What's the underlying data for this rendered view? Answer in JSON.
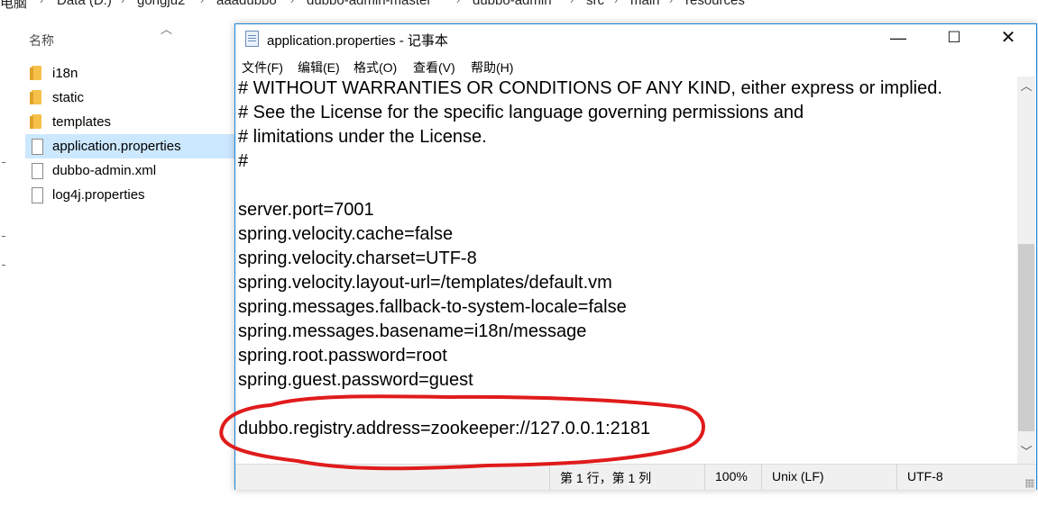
{
  "explorer": {
    "breadcrumb": [
      "此电脑",
      "Data (D:)",
      "gongju2",
      "aaadubbo",
      "dubbo-admin-master",
      "dubbo-admin",
      "src",
      "main",
      "resources"
    ],
    "column_header": "名称",
    "files": [
      {
        "name": "i18n",
        "type": "folder"
      },
      {
        "name": "static",
        "type": "folder"
      },
      {
        "name": "templates",
        "type": "folder"
      },
      {
        "name": "application.properties",
        "type": "file",
        "selected": true
      },
      {
        "name": "dubbo-admin.xml",
        "type": "file"
      },
      {
        "name": "log4j.properties",
        "type": "file"
      }
    ]
  },
  "notepad": {
    "title": "application.properties - 记事本",
    "menu": [
      "文件(F)",
      "编辑(E)",
      "格式(O)",
      "查看(V)",
      "帮助(H)"
    ],
    "lines": [
      "# WITHOUT WARRANTIES OR CONDITIONS OF ANY KIND, either express or implied.",
      "# See the License for the specific language governing permissions and",
      "# limitations under the License.",
      "#",
      "",
      "server.port=7001",
      "spring.velocity.cache=false",
      "spring.velocity.charset=UTF-8",
      "spring.velocity.layout-url=/templates/default.vm",
      "spring.messages.fallback-to-system-locale=false",
      "spring.messages.basename=i18n/message",
      "spring.root.password=root",
      "spring.guest.password=guest",
      "",
      "dubbo.registry.address=zookeeper://127.0.0.1:2181"
    ],
    "status": {
      "position": "第 1 行，第 1 列",
      "zoom": "100%",
      "line_ending": "Unix (LF)",
      "encoding": "UTF-8"
    }
  },
  "annotation_color": "#e01b1b",
  "accent_color": "#1883d7"
}
